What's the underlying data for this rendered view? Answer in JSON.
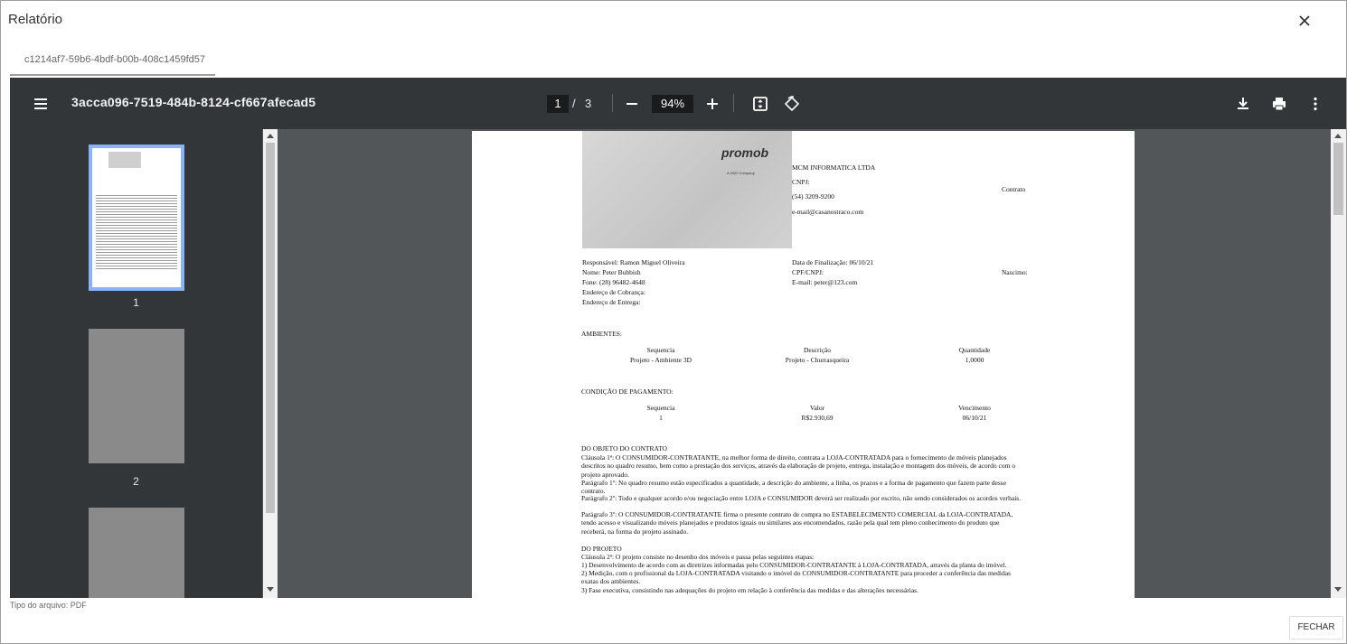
{
  "dialog": {
    "title": "Relatório",
    "tab_label": "c1214af7-59b6-4bdf-b00b-408c1459fd57",
    "file_type": "Tipo do arquivo: PDF",
    "close_label": "FECHAR"
  },
  "viewer": {
    "doc_title": "3acca096-7519-484b-8124-cf667afecad5",
    "current_page": "1",
    "page_separator": "/",
    "total_pages": "3",
    "zoom": "94%",
    "thumb_labels": [
      "1",
      "2"
    ]
  },
  "document": {
    "logo": {
      "brand": "promob",
      "tagline": "A 2020 Company"
    },
    "company": {
      "name": "MCM INFORMATICA LTDA",
      "cnpj": "CNPJ:",
      "phone": "(54) 3209-9200",
      "email": "e-mail@casanostraco.com",
      "contract_label": "Contrato"
    },
    "client": {
      "responsavel": "Responsável: Ramon Miguel Oliveira",
      "data_finalizacao": "Data de Finalização: 06/10/21",
      "nome": "Nome: Peter Bubbish",
      "cpf": "CPF/CNPJ:",
      "nascimento": "Nascimo:",
      "fone": "Fone: (28) 96482-4648",
      "email": "E-mail: peter@123.com",
      "cobranca": "Endereço de Cobrança:",
      "entrega": "Endereço de Entrega:"
    },
    "ambientes": {
      "heading": "AMBIENTES:",
      "headers": [
        "Sequencia",
        "Descrição",
        "Quantidade"
      ],
      "row": [
        "Projeto - Ambiente 3D",
        "Projeto - Churrasqueira",
        "1,0000"
      ]
    },
    "pagamento": {
      "heading": "CONDIÇÃO DE PAGAMENTO:",
      "headers": [
        "Sequencia",
        "Valor",
        "Vencimento"
      ],
      "row": [
        "1",
        "R$2.930,69",
        "06/10/21"
      ]
    },
    "objeto_heading": "DO OBJETO DO CONTRATO",
    "clausula1": "Cláusula 1ª: O CONSUMIDOR-CONTRATANTE, na melhor forma de direito, contrata a LOJA-CONTRATADA para o fornecimento de móveis planejados descritos no quadro resumo, bem como a prestação dos serviços, através da elaboração de projeto, entrega, instalação e montagem dos móveis, de acordo com o projeto aprovado.",
    "paragrafo1": "Parágrafo 1º: No quadro resumo estão especificados a quantidade, a descrição do ambiente, a linha, os prazos e a forma de pagamento que fazem parte desse contrato.",
    "paragrafo2": "Parágrafo 2º: Todo e qualquer acordo e/ou negociação entre LOJA e CONSUMIDOR deverá ser realizado por escrito, não sendo considerados os acordos verbais.",
    "paragrafo3": "Parágrafo 3º: O CONSUMIDOR-CONTRATANTE firma o presente contrato de compra no ESTABELECIMENTO COMERCIAL da LOJA-CONTRATADA, tendo acesso e visualizando móveis planejados e produtos iguais ou similares aos encomendados, razão pela qual tem pleno conhecimento do produto que receberá, na forma do projeto assinado.",
    "projeto_heading": "DO PROJETO",
    "clausula2": "Cláusula 2ª: O projeto consiste no desenho dos móveis e passa pelas seguintes etapas:",
    "item1": "1)      Desenvolvimento de acordo com as diretrizes informadas pelo CONSUMIDOR-CONTRATANTE à LOJA-CONTRATADA, através da planta do imóvel.",
    "item2": "2)      Medição, com o profissional da LOJA-CONTRATADA visitando o imóvel do CONSUMIDOR-CONTRATANTE para proceder a conferência das medidas exatas dos ambientes.",
    "item3": "3)      Fase executiva, consistindo nas adequações do projeto em relação à conferência das medidas e das alterações necessárias."
  }
}
